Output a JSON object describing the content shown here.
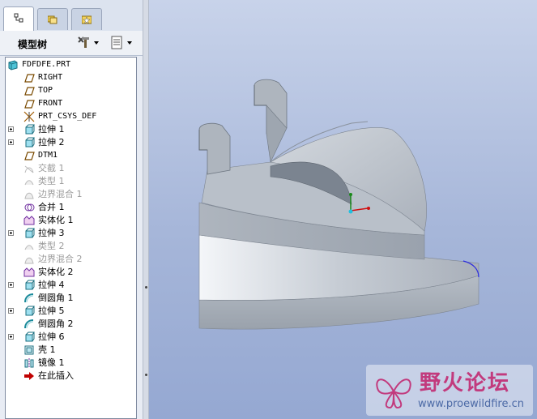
{
  "panel": {
    "title": "模型树"
  },
  "tabs": [
    {
      "icon": "model-tree-icon",
      "active": true
    },
    {
      "icon": "folder-browser-icon",
      "active": false
    },
    {
      "icon": "favorites-icon",
      "active": false
    }
  ],
  "tree": {
    "root": "FDFDFE.PRT",
    "items": [
      {
        "label": "RIGHT",
        "icon": "datum-plane-icon",
        "expand": false,
        "state": "normal",
        "mono": true
      },
      {
        "label": "TOP",
        "icon": "datum-plane-icon",
        "expand": false,
        "state": "normal",
        "mono": true
      },
      {
        "label": "FRONT",
        "icon": "datum-plane-icon",
        "expand": false,
        "state": "normal",
        "mono": true
      },
      {
        "label": "PRT_CSYS_DEF",
        "icon": "csys-icon",
        "expand": false,
        "state": "normal",
        "mono": true
      },
      {
        "label": "拉伸 1",
        "icon": "extrude-icon",
        "expand": true,
        "state": "normal",
        "mono": false
      },
      {
        "label": "拉伸 2",
        "icon": "extrude-icon",
        "expand": true,
        "state": "normal",
        "mono": false
      },
      {
        "label": "DTM1",
        "icon": "datum-plane-icon",
        "expand": false,
        "state": "normal",
        "mono": true
      },
      {
        "label": "交截 1",
        "icon": "intersect-icon",
        "expand": false,
        "state": "suppressed",
        "mono": false
      },
      {
        "label": "类型 1",
        "icon": "type-icon",
        "expand": false,
        "state": "suppressed",
        "mono": false
      },
      {
        "label": "边界混合 1",
        "icon": "boundary-blend-icon",
        "expand": false,
        "state": "suppressed",
        "mono": false
      },
      {
        "label": "合并 1",
        "icon": "merge-icon",
        "expand": false,
        "state": "normal",
        "mono": false
      },
      {
        "label": "实体化 1",
        "icon": "solidify-icon",
        "expand": false,
        "state": "normal",
        "mono": false
      },
      {
        "label": "拉伸 3",
        "icon": "extrude-icon",
        "expand": true,
        "state": "normal",
        "mono": false
      },
      {
        "label": "类型 2",
        "icon": "type-icon",
        "expand": false,
        "state": "suppressed",
        "mono": false
      },
      {
        "label": "边界混合 2",
        "icon": "boundary-blend-icon",
        "expand": false,
        "state": "suppressed",
        "mono": false
      },
      {
        "label": "实体化 2",
        "icon": "solidify-icon",
        "expand": false,
        "state": "normal",
        "mono": false
      },
      {
        "label": "拉伸 4",
        "icon": "extrude-icon",
        "expand": true,
        "state": "normal",
        "mono": false
      },
      {
        "label": "倒圆角 1",
        "icon": "round-icon",
        "expand": false,
        "state": "normal",
        "mono": false
      },
      {
        "label": "拉伸 5",
        "icon": "extrude-icon",
        "expand": true,
        "state": "normal",
        "mono": false
      },
      {
        "label": "倒圆角 2",
        "icon": "round-icon",
        "expand": false,
        "state": "normal",
        "mono": false
      },
      {
        "label": "拉伸 6",
        "icon": "extrude-icon",
        "expand": true,
        "state": "normal",
        "mono": false
      },
      {
        "label": "壳 1",
        "icon": "shell-icon",
        "expand": false,
        "state": "normal",
        "mono": false
      },
      {
        "label": "镜像 1",
        "icon": "mirror-icon",
        "expand": false,
        "state": "normal",
        "mono": false
      },
      {
        "label": "在此插入",
        "icon": "insert-here-icon",
        "expand": false,
        "state": "normal",
        "mono": false
      }
    ]
  },
  "watermark": {
    "brand": "野火论坛",
    "url": "www.proewildfire.cn"
  },
  "colors": {
    "model": "#b7bec8",
    "viewport_top": "#c8d3ea",
    "viewport_bottom": "#95a8d2",
    "insert_arrow": "#c00000"
  }
}
